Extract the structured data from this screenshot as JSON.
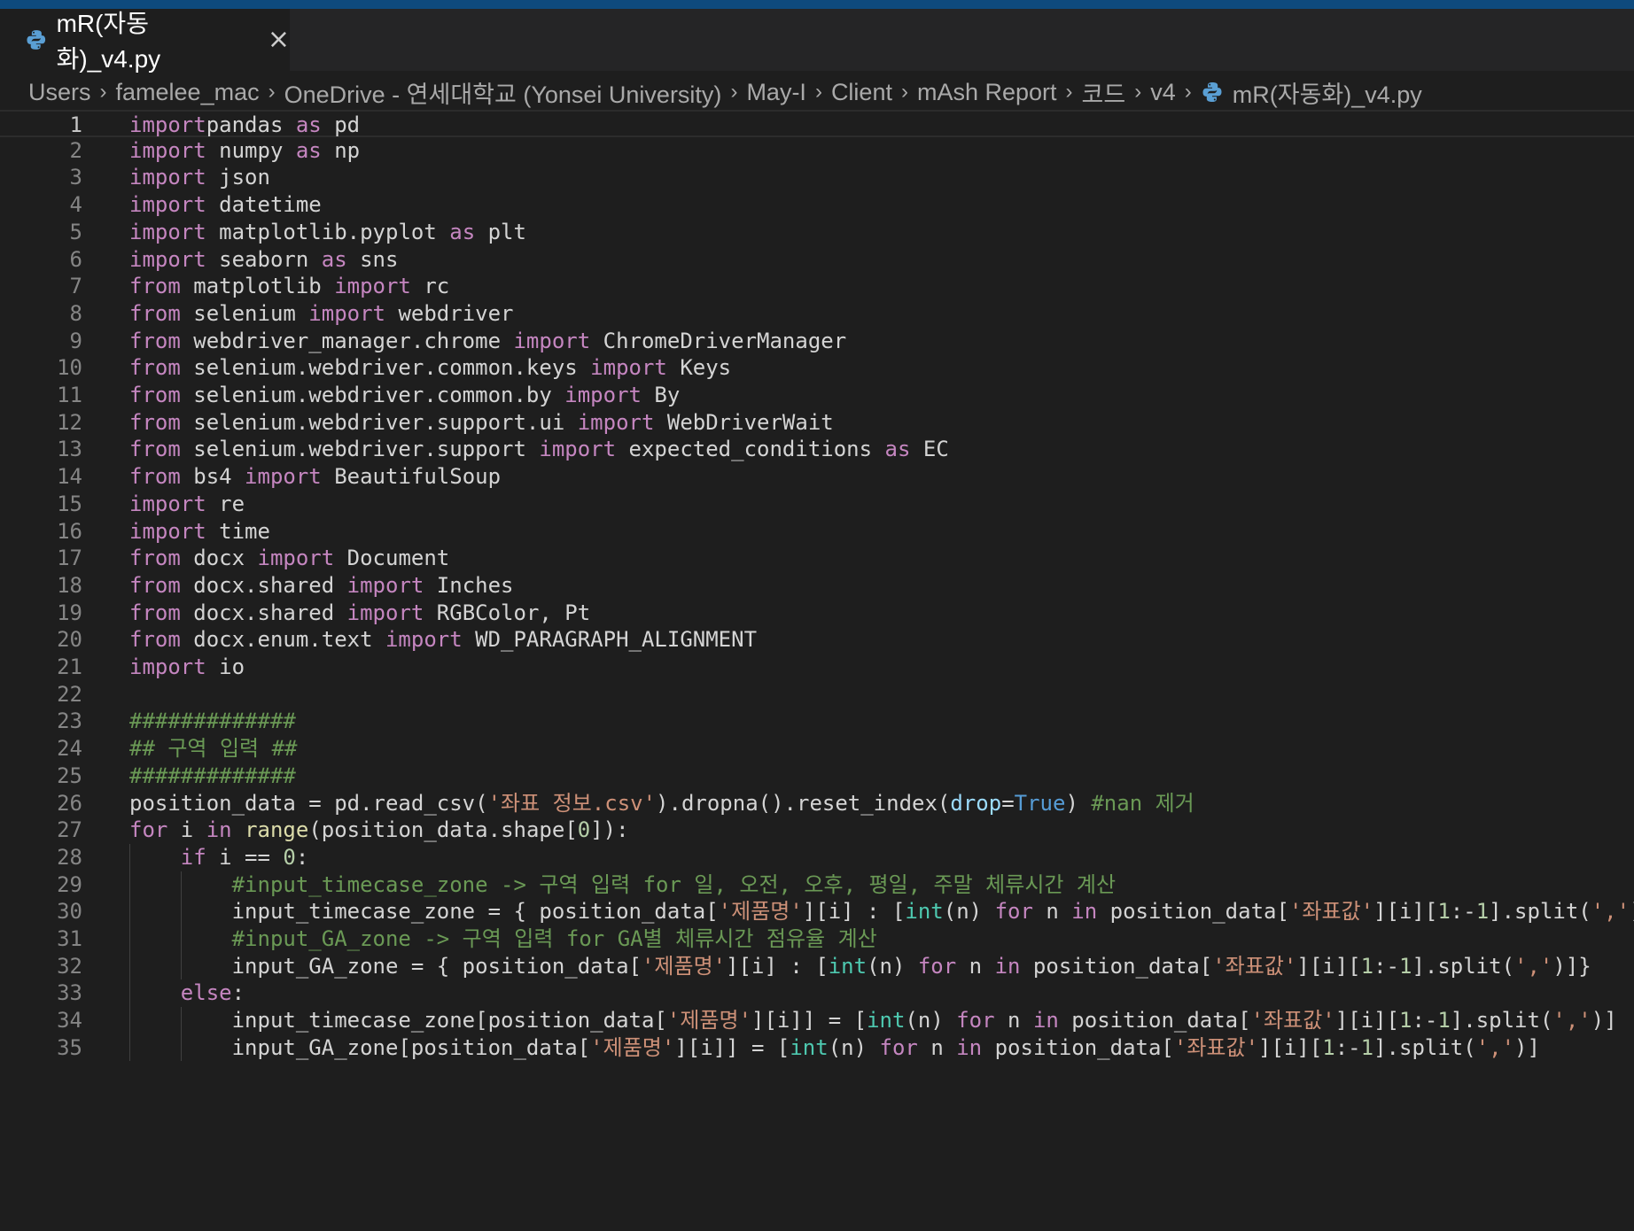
{
  "tab": {
    "label": "mR(자동화)_v4.py",
    "icon": "python-file-icon",
    "close_glyph": "×"
  },
  "breadcrumb": {
    "items": [
      "Users",
      "famelee_mac",
      "OneDrive - 연세대학교 (Yonsei University)",
      "May-I",
      "Client",
      "mAsh Report",
      "코드",
      "v4"
    ],
    "file": "mR(자동화)_v4.py",
    "separator": "›"
  },
  "editor": {
    "active_line": 1,
    "lines": [
      {
        "n": "1",
        "indent": 0,
        "tokens": [
          [
            "kw",
            "import"
          ],
          [
            "",
            "pandas "
          ],
          [
            "kw",
            "as"
          ],
          [
            "",
            " pd"
          ]
        ]
      },
      {
        "n": "2",
        "indent": 0,
        "tokens": [
          [
            "kw",
            "import"
          ],
          [
            "",
            " numpy "
          ],
          [
            "kw",
            "as"
          ],
          [
            "",
            " np"
          ]
        ]
      },
      {
        "n": "3",
        "indent": 0,
        "tokens": [
          [
            "kw",
            "import"
          ],
          [
            "",
            " json"
          ]
        ]
      },
      {
        "n": "4",
        "indent": 0,
        "tokens": [
          [
            "kw",
            "import"
          ],
          [
            "",
            " datetime"
          ]
        ]
      },
      {
        "n": "5",
        "indent": 0,
        "tokens": [
          [
            "kw",
            "import"
          ],
          [
            "",
            " matplotlib.pyplot "
          ],
          [
            "kw",
            "as"
          ],
          [
            "",
            " plt"
          ]
        ]
      },
      {
        "n": "6",
        "indent": 0,
        "tokens": [
          [
            "kw",
            "import"
          ],
          [
            "",
            " seaborn "
          ],
          [
            "kw",
            "as"
          ],
          [
            "",
            " sns"
          ]
        ]
      },
      {
        "n": "7",
        "indent": 0,
        "tokens": [
          [
            "kw",
            "from"
          ],
          [
            "",
            " matplotlib "
          ],
          [
            "kw",
            "import"
          ],
          [
            "",
            " rc"
          ]
        ]
      },
      {
        "n": "8",
        "indent": 0,
        "tokens": [
          [
            "kw",
            "from"
          ],
          [
            "",
            " selenium "
          ],
          [
            "kw",
            "import"
          ],
          [
            "",
            " webdriver"
          ]
        ]
      },
      {
        "n": "9",
        "indent": 0,
        "tokens": [
          [
            "kw",
            "from"
          ],
          [
            "",
            " webdriver_manager.chrome "
          ],
          [
            "kw",
            "import"
          ],
          [
            "",
            " ChromeDriverManager"
          ]
        ]
      },
      {
        "n": "10",
        "indent": 0,
        "tokens": [
          [
            "kw",
            "from"
          ],
          [
            "",
            " selenium.webdriver.common.keys "
          ],
          [
            "kw",
            "import"
          ],
          [
            "",
            " Keys"
          ]
        ]
      },
      {
        "n": "11",
        "indent": 0,
        "tokens": [
          [
            "kw",
            "from"
          ],
          [
            "",
            " selenium.webdriver.common.by "
          ],
          [
            "kw",
            "import"
          ],
          [
            "",
            " By"
          ]
        ]
      },
      {
        "n": "12",
        "indent": 0,
        "tokens": [
          [
            "kw",
            "from"
          ],
          [
            "",
            " selenium.webdriver.support.ui "
          ],
          [
            "kw",
            "import"
          ],
          [
            "",
            " WebDriverWait"
          ]
        ]
      },
      {
        "n": "13",
        "indent": 0,
        "tokens": [
          [
            "kw",
            "from"
          ],
          [
            "",
            " selenium.webdriver.support "
          ],
          [
            "kw",
            "import"
          ],
          [
            "",
            " expected_conditions "
          ],
          [
            "kw",
            "as"
          ],
          [
            "",
            " EC"
          ]
        ]
      },
      {
        "n": "14",
        "indent": 0,
        "tokens": [
          [
            "kw",
            "from"
          ],
          [
            "",
            " bs4 "
          ],
          [
            "kw",
            "import"
          ],
          [
            "",
            " BeautifulSoup"
          ]
        ]
      },
      {
        "n": "15",
        "indent": 0,
        "tokens": [
          [
            "kw",
            "import"
          ],
          [
            "",
            " re"
          ]
        ]
      },
      {
        "n": "16",
        "indent": 0,
        "tokens": [
          [
            "kw",
            "import"
          ],
          [
            "",
            " time"
          ]
        ]
      },
      {
        "n": "17",
        "indent": 0,
        "tokens": [
          [
            "kw",
            "from"
          ],
          [
            "",
            " docx "
          ],
          [
            "kw",
            "import"
          ],
          [
            "",
            " Document"
          ]
        ]
      },
      {
        "n": "18",
        "indent": 0,
        "tokens": [
          [
            "kw",
            "from"
          ],
          [
            "",
            " docx.shared "
          ],
          [
            "kw",
            "import"
          ],
          [
            "",
            " Inches"
          ]
        ]
      },
      {
        "n": "19",
        "indent": 0,
        "tokens": [
          [
            "kw",
            "from"
          ],
          [
            "",
            " docx.shared "
          ],
          [
            "kw",
            "import"
          ],
          [
            "",
            " RGBColor, Pt"
          ]
        ]
      },
      {
        "n": "20",
        "indent": 0,
        "tokens": [
          [
            "kw",
            "from"
          ],
          [
            "",
            " docx.enum.text "
          ],
          [
            "kw",
            "import"
          ],
          [
            "",
            " WD_PARAGRAPH_ALIGNMENT"
          ]
        ]
      },
      {
        "n": "21",
        "indent": 0,
        "tokens": [
          [
            "kw",
            "import"
          ],
          [
            "",
            " io"
          ]
        ]
      },
      {
        "n": "22",
        "indent": 0,
        "tokens": []
      },
      {
        "n": "23",
        "indent": 0,
        "tokens": [
          [
            "cm",
            "#############"
          ]
        ]
      },
      {
        "n": "24",
        "indent": 0,
        "tokens": [
          [
            "cm",
            "## 구역 입력 ##"
          ]
        ]
      },
      {
        "n": "25",
        "indent": 0,
        "tokens": [
          [
            "cm",
            "#############"
          ]
        ]
      },
      {
        "n": "26",
        "indent": 0,
        "tokens": [
          [
            "",
            "position_data = pd.read_csv("
          ],
          [
            "str",
            "'좌표 정보.csv'"
          ],
          [
            "",
            ").dropna().reset_index("
          ],
          [
            "prm",
            "drop"
          ],
          [
            "",
            "="
          ],
          [
            "cst",
            "True"
          ],
          [
            "",
            ") "
          ],
          [
            "cm",
            "#nan 제거"
          ]
        ]
      },
      {
        "n": "27",
        "indent": 0,
        "tokens": [
          [
            "ctl",
            "for"
          ],
          [
            "",
            " i "
          ],
          [
            "ctl",
            "in"
          ],
          [
            "",
            " "
          ],
          [
            "bi",
            "range"
          ],
          [
            "",
            "(position_data.shape["
          ],
          [
            "num",
            "0"
          ],
          [
            "",
            "]):"
          ]
        ]
      },
      {
        "n": "28",
        "indent": 1,
        "tokens": [
          [
            "",
            "    "
          ],
          [
            "ctl",
            "if"
          ],
          [
            "",
            " i == "
          ],
          [
            "num",
            "0"
          ],
          [
            "",
            ":"
          ]
        ]
      },
      {
        "n": "29",
        "indent": 2,
        "tokens": [
          [
            "",
            "        "
          ],
          [
            "cm",
            "#input_timecase_zone -> 구역 입력 for 일, 오전, 오후, 평일, 주말 체류시간 계산"
          ]
        ]
      },
      {
        "n": "30",
        "indent": 2,
        "tokens": [
          [
            "",
            "        input_timecase_zone = { position_data["
          ],
          [
            "str",
            "'제품명'"
          ],
          [
            "",
            "][i] : ["
          ],
          [
            "tt",
            "int"
          ],
          [
            "",
            "(n) "
          ],
          [
            "ctl",
            "for"
          ],
          [
            "",
            " n "
          ],
          [
            "ctl",
            "in"
          ],
          [
            "",
            " position_data["
          ],
          [
            "str",
            "'좌표값'"
          ],
          [
            "",
            "][i]["
          ],
          [
            "num",
            "1"
          ],
          [
            "",
            ":-"
          ],
          [
            "num",
            "1"
          ],
          [
            "",
            "].split("
          ],
          [
            "str",
            "','"
          ],
          [
            "",
            ")]}"
          ]
        ]
      },
      {
        "n": "31",
        "indent": 2,
        "tokens": [
          [
            "",
            "        "
          ],
          [
            "cm",
            "#input_GA_zone -> 구역 입력 for GA별 체류시간 점유율 계산"
          ]
        ]
      },
      {
        "n": "32",
        "indent": 2,
        "tokens": [
          [
            "",
            "        input_GA_zone = { position_data["
          ],
          [
            "str",
            "'제품명'"
          ],
          [
            "",
            "][i] : ["
          ],
          [
            "tt",
            "int"
          ],
          [
            "",
            "(n) "
          ],
          [
            "ctl",
            "for"
          ],
          [
            "",
            " n "
          ],
          [
            "ctl",
            "in"
          ],
          [
            "",
            " position_data["
          ],
          [
            "str",
            "'좌표값'"
          ],
          [
            "",
            "][i]["
          ],
          [
            "num",
            "1"
          ],
          [
            "",
            ":-"
          ],
          [
            "num",
            "1"
          ],
          [
            "",
            "].split("
          ],
          [
            "str",
            "','"
          ],
          [
            "",
            ")]}"
          ]
        ]
      },
      {
        "n": "33",
        "indent": 1,
        "tokens": [
          [
            "",
            "    "
          ],
          [
            "ctl",
            "else"
          ],
          [
            "",
            ":"
          ]
        ]
      },
      {
        "n": "34",
        "indent": 2,
        "tokens": [
          [
            "",
            "        input_timecase_zone[position_data["
          ],
          [
            "str",
            "'제품명'"
          ],
          [
            "",
            "][i]] = ["
          ],
          [
            "tt",
            "int"
          ],
          [
            "",
            "(n) "
          ],
          [
            "ctl",
            "for"
          ],
          [
            "",
            " n "
          ],
          [
            "ctl",
            "in"
          ],
          [
            "",
            " position_data["
          ],
          [
            "str",
            "'좌표값'"
          ],
          [
            "",
            "][i]["
          ],
          [
            "num",
            "1"
          ],
          [
            "",
            ":-"
          ],
          [
            "num",
            "1"
          ],
          [
            "",
            "].split("
          ],
          [
            "str",
            "','"
          ],
          [
            "",
            ")]"
          ]
        ]
      },
      {
        "n": "35",
        "indent": 2,
        "tokens": [
          [
            "",
            "        input_GA_zone[position_data["
          ],
          [
            "str",
            "'제품명'"
          ],
          [
            "",
            "][i]] = ["
          ],
          [
            "tt",
            "int"
          ],
          [
            "",
            "(n) "
          ],
          [
            "ctl",
            "for"
          ],
          [
            "",
            " n "
          ],
          [
            "ctl",
            "in"
          ],
          [
            "",
            " position_data["
          ],
          [
            "str",
            "'좌표값'"
          ],
          [
            "",
            "][i]["
          ],
          [
            "num",
            "1"
          ],
          [
            "",
            ":-"
          ],
          [
            "num",
            "1"
          ],
          [
            "",
            "].split("
          ],
          [
            "str",
            "','"
          ],
          [
            "",
            ")]"
          ]
        ]
      }
    ]
  },
  "colors": {
    "background": "#1e1e1e",
    "keyword": "#c586c0",
    "string": "#ce9178",
    "comment": "#6a9955",
    "number": "#b5cea8",
    "builtin_type": "#4ec9b0",
    "function": "#dcdcaa",
    "constant": "#569cd6",
    "parameter": "#9cdcfe",
    "accent_bar": "#0e4a7d"
  }
}
